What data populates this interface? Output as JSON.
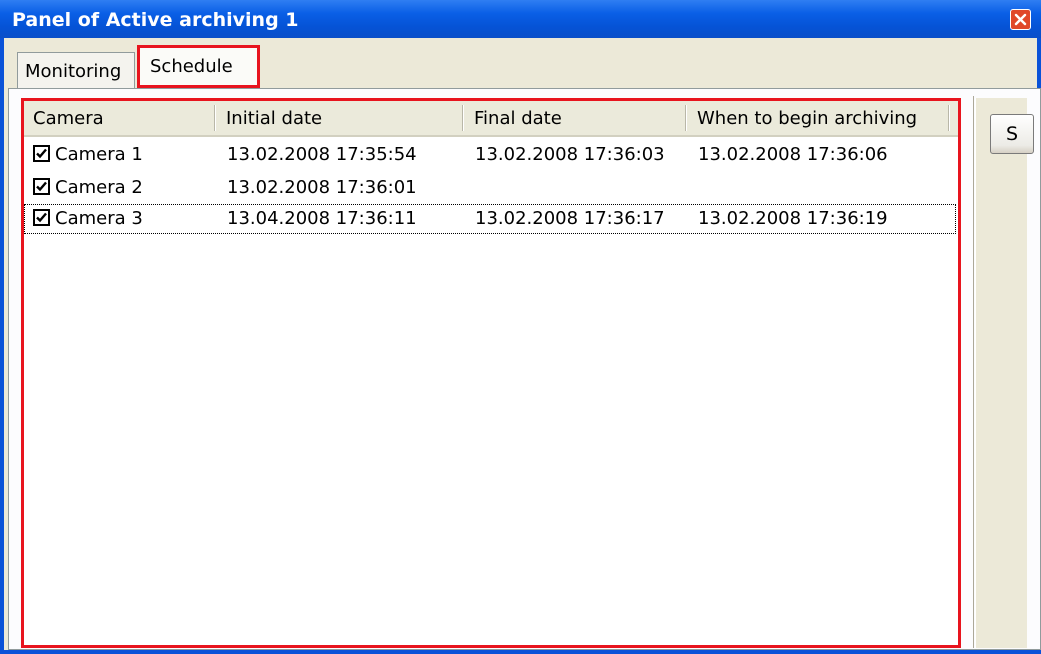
{
  "window": {
    "title": "Panel of Active archiving 1",
    "close_icon": "close-icon",
    "accent": "#0a52d8",
    "highlight": "#e8141e"
  },
  "tabs": [
    {
      "label": "Monitoring",
      "selected": false
    },
    {
      "label": "Schedule",
      "selected": true
    }
  ],
  "table": {
    "columns": [
      "Camera",
      "Initial date",
      "Final date",
      "When to begin archiving"
    ],
    "rows": [
      {
        "checked": true,
        "camera": "Camera 1",
        "initial": "13.02.2008 17:35:54",
        "final": "13.02.2008 17:36:03",
        "begin": "13.02.2008 17:36:06"
      },
      {
        "checked": true,
        "camera": "Camera 2",
        "initial": "13.02.2008 17:36:01",
        "final": "",
        "begin": ""
      },
      {
        "checked": true,
        "camera": "Camera 3",
        "initial": "13.04.2008 17:36:11",
        "final": "13.02.2008 17:36:17",
        "begin": "13.02.2008 17:36:19"
      }
    ]
  },
  "side": {
    "button_label": "S"
  }
}
